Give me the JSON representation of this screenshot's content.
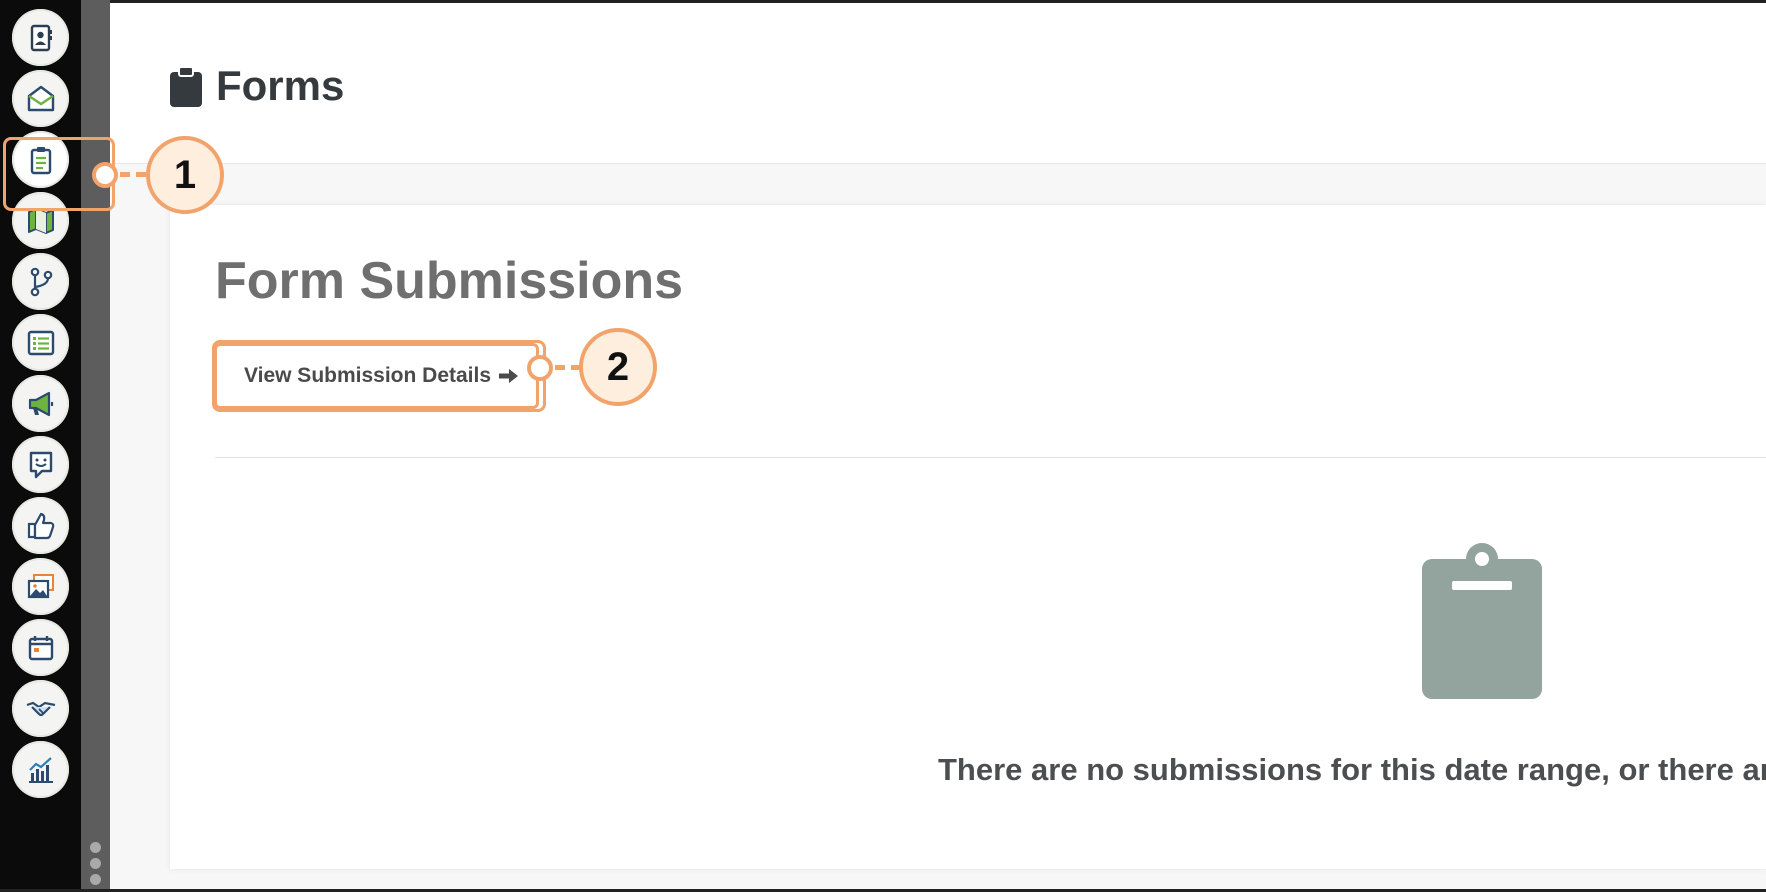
{
  "sidebar": {
    "items": [
      {
        "icon": "contacts-icon"
      },
      {
        "icon": "email-icon"
      },
      {
        "icon": "forms-clipboard-icon",
        "active": true
      },
      {
        "icon": "map-icon"
      },
      {
        "icon": "workflow-branch-icon"
      },
      {
        "icon": "list-icon"
      },
      {
        "icon": "megaphone-icon"
      },
      {
        "icon": "feedback-icon"
      },
      {
        "icon": "thumbs-up-icon"
      },
      {
        "icon": "media-gallery-icon"
      },
      {
        "icon": "calendar-icon"
      },
      {
        "icon": "handshake-icon"
      },
      {
        "icon": "analytics-chart-icon"
      }
    ],
    "more_icon": "vertical-dots-icon"
  },
  "header": {
    "icon": "clipboard-icon",
    "title": "Forms"
  },
  "main": {
    "section_title": "Form Submissions",
    "view_button_label": "View Submission Details",
    "view_button_icon": "arrow-right-icon",
    "empty_state": {
      "icon": "clipboard-icon",
      "message": "There are no submissions for this date range, or there are"
    }
  },
  "annotations": {
    "callout_1": "1",
    "callout_2": "2"
  },
  "colors": {
    "accent": "#f2a36b",
    "rail": "#0b0b0b",
    "title_text": "#343a3d",
    "empty_icon": "#93a39e"
  }
}
